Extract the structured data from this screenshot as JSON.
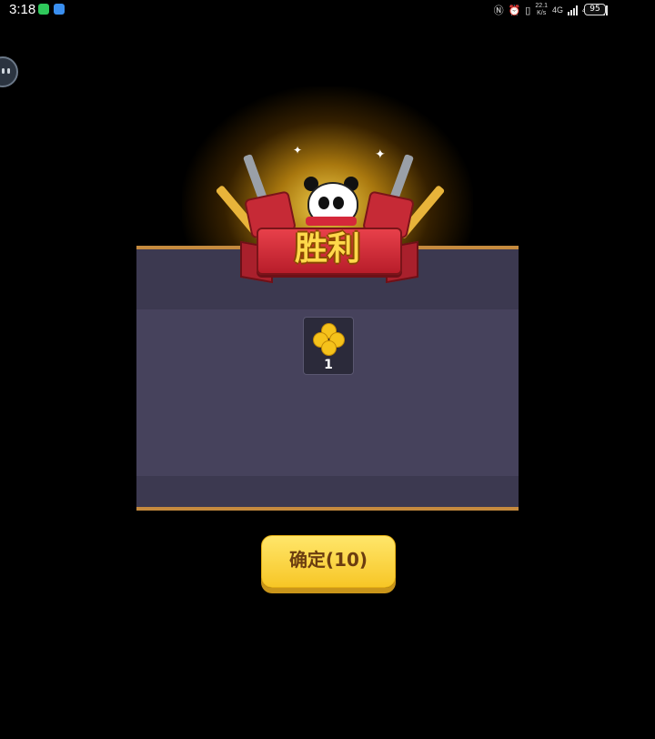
{
  "status_bar": {
    "time": "3:18",
    "speed_value": "22.1",
    "speed_unit": "K/s",
    "network_1": "4G",
    "network_2": "4G",
    "battery": "95"
  },
  "dialog": {
    "title": "胜利",
    "rewards": [
      {
        "icon": "clover-icon",
        "count": "1"
      }
    ],
    "confirm_button": {
      "label": "确定(10)"
    }
  },
  "colors": {
    "panel_body": "#46425c",
    "panel_header": "#3c3950",
    "panel_border": "#c58a3e",
    "ribbon": "#d5283a",
    "title_text": "#ffd84a",
    "button": "#f7c626"
  }
}
